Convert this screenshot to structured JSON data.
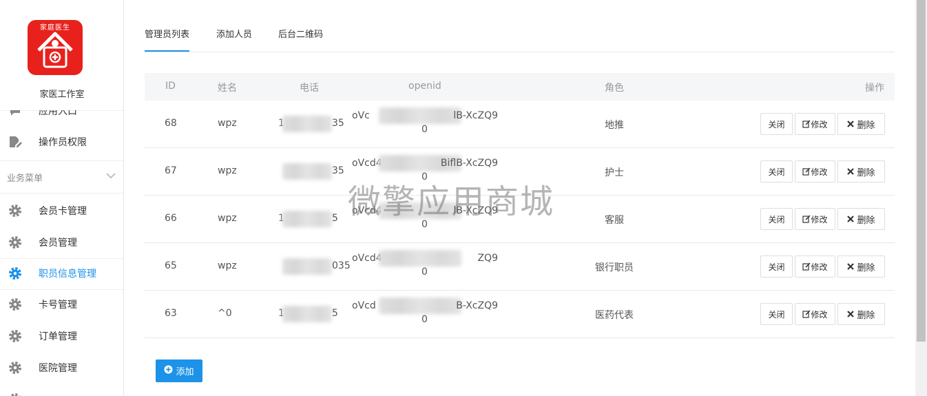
{
  "sidebar": {
    "logo_text": "家庭医生",
    "studio_name": "家医工作室",
    "items": [
      {
        "label": "应用入口",
        "icon": "chat-icon"
      },
      {
        "label": "操作员权限",
        "icon": "document-edit-icon"
      },
      {
        "label": "会员卡管理",
        "icon": "gear-icon"
      },
      {
        "label": "会员管理",
        "icon": "gear-icon"
      },
      {
        "label": "职员信息管理",
        "icon": "gear-icon"
      },
      {
        "label": "卡号管理",
        "icon": "gear-icon"
      },
      {
        "label": "订单管理",
        "icon": "gear-icon"
      },
      {
        "label": "医院管理",
        "icon": "gear-icon"
      }
    ],
    "section_label": "业务菜单"
  },
  "tabs": [
    {
      "label": "管理员列表"
    },
    {
      "label": "添加人员"
    },
    {
      "label": "后台二维码"
    }
  ],
  "table": {
    "headers": {
      "id": "ID",
      "name": "姓名",
      "phone": "电话",
      "openid": "openid",
      "role": "角色",
      "ops": "操作"
    },
    "rows": [
      {
        "id": "68",
        "name": "wpz",
        "phone_start": "1",
        "phone_end": "35",
        "openid_start": "oVc",
        "openid_end": "lB-XcZQ9",
        "openid_line2": "0",
        "role": "地推"
      },
      {
        "id": "67",
        "name": "wpz",
        "phone_start": "",
        "phone_end": "35",
        "openid_start": "oVcd4wz",
        "openid_end": "BiflB-XcZQ9",
        "openid_line2": "0",
        "role": "护士"
      },
      {
        "id": "66",
        "name": "wpz",
        "phone_start": "1",
        "phone_end": "5",
        "openid_start": "oVcd4wz",
        "openid_end": "lB-XcZQ9",
        "openid_line2": "0",
        "role": "客服"
      },
      {
        "id": "65",
        "name": "wpz",
        "phone_start": "",
        "phone_end": "035",
        "openid_start": "oVcd4wzu",
        "openid_end": "ZQ9",
        "openid_line2": "0",
        "role": "银行职员"
      },
      {
        "id": "63",
        "name": "^0",
        "phone_start": "1",
        "phone_end": "5",
        "openid_start": "oVcd",
        "openid_end": "B-XcZQ9",
        "openid_line2": "0",
        "role": "医药代表"
      }
    ],
    "btn_close": "关闭",
    "btn_edit": "修改",
    "btn_delete": "删除"
  },
  "add_button": "添加",
  "watermark": "微擎应用商城",
  "colors": {
    "accent": "#1c92e8",
    "logo_red": "#e8211d"
  }
}
